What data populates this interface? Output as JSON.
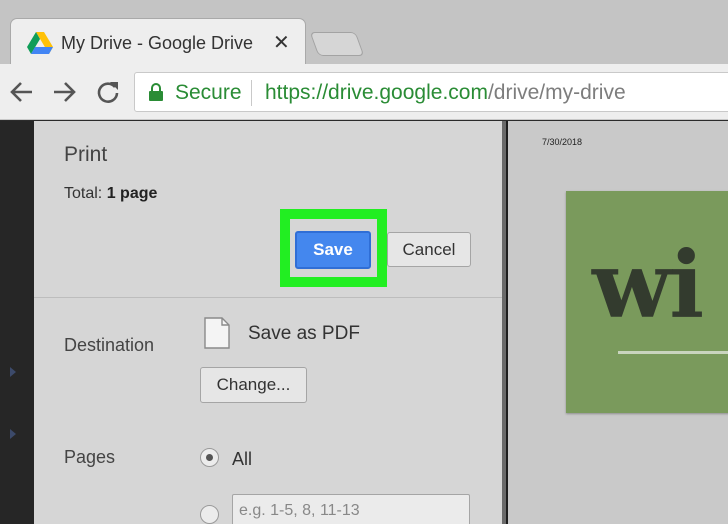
{
  "browser": {
    "tab_title": "My Drive - Google Drive",
    "tab_close": "✕",
    "secure_label": "Secure",
    "url_host": "https://drive.google.com",
    "url_path": "/drive/my-drive"
  },
  "print_dialog": {
    "title": "Print",
    "total_label": "Total:",
    "total_value": "1 page",
    "save_label": "Save",
    "cancel_label": "Cancel",
    "destination_label": "Destination",
    "destination_value": "Save as PDF",
    "change_label": "Change...",
    "pages_label": "Pages",
    "pages_all_label": "All",
    "pages_all_selected": true,
    "pages_custom_placeholder": "e.g. 1-5, 8, 11-13"
  },
  "preview": {
    "date": "7/30/2018",
    "logo_text": "wi"
  },
  "colors": {
    "highlight": "#22ee22",
    "save_button": "#4487ee",
    "secure_green": "#2a8c35",
    "logo_green": "#7a9a5c"
  },
  "icons": [
    "google-drive-icon",
    "back-arrow-icon",
    "forward-arrow-icon",
    "reload-icon",
    "lock-icon",
    "pdf-file-icon"
  ]
}
